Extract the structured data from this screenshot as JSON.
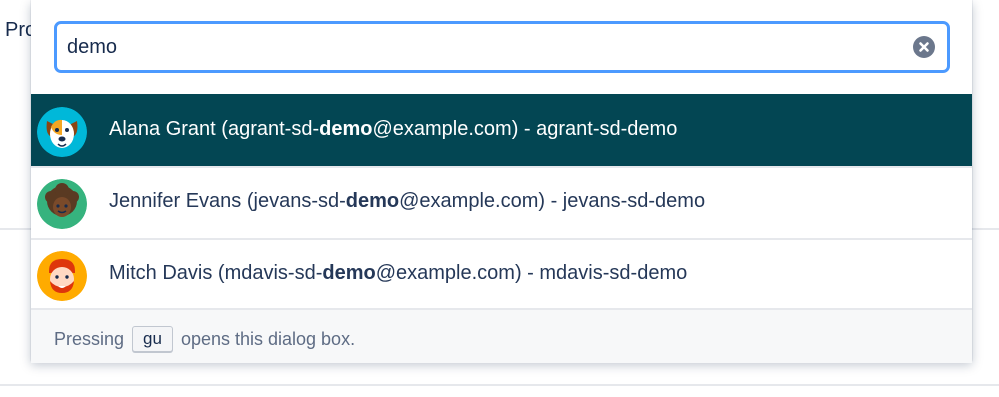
{
  "background": {
    "fragment_text": "Pro"
  },
  "search": {
    "value": "demo",
    "clear_icon": "clear-icon"
  },
  "results": [
    {
      "name": "Alana Grant",
      "email_prefix": "(agrant-sd-",
      "email_match": "demo",
      "email_suffix": "@example.com)",
      "username": " - agrant-sd-demo",
      "avatar_icon": "dog-avatar",
      "selected": true
    },
    {
      "name": "Jennifer Evans",
      "email_prefix": "(jevans-sd-",
      "email_match": "demo",
      "email_suffix": "@example.com)",
      "username": " - jevans-sd-demo",
      "avatar_icon": "woman-avatar",
      "selected": false
    },
    {
      "name": "Mitch Davis",
      "email_prefix": "(mdavis-sd-",
      "email_match": "demo",
      "email_suffix": "@example.com)",
      "username": " - mdavis-sd-demo",
      "avatar_icon": "man-avatar",
      "selected": false
    }
  ],
  "footer": {
    "prefix": "Pressing",
    "shortcut": "gu",
    "suffix": "opens this dialog box."
  },
  "colors": {
    "selected_bg": "#034653",
    "focus_border": "#4c9aff",
    "text": "#253858"
  }
}
